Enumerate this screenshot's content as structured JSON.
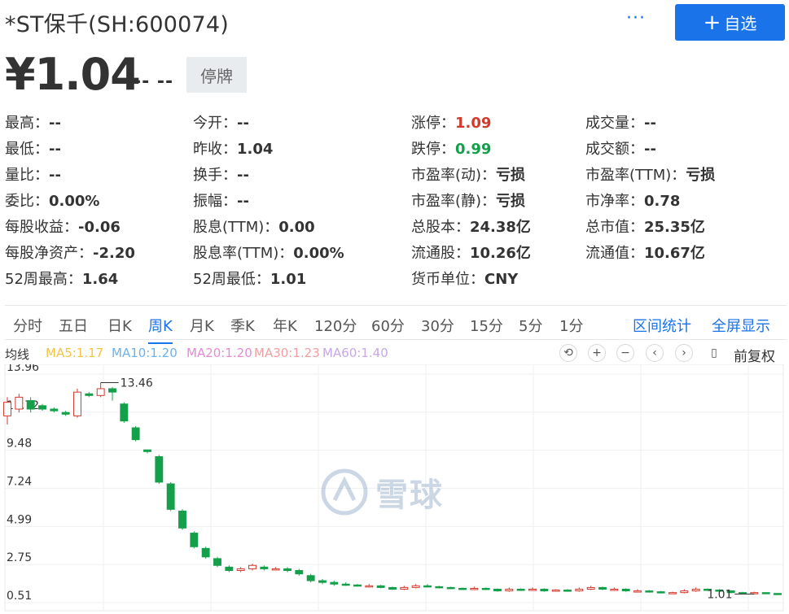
{
  "header": {
    "title": "*ST保千(SH:600074)",
    "more_label": "···",
    "add_label": "自选",
    "add_icon": "plus-icon"
  },
  "price": {
    "current": "¥1.04",
    "change": "-- --",
    "status": "停牌"
  },
  "quotes": [
    {
      "label": "最高：",
      "value": "--",
      "tone": ""
    },
    {
      "label": "今开：",
      "value": "--",
      "tone": ""
    },
    {
      "label": "涨停：",
      "value": "1.09",
      "tone": "up"
    },
    {
      "label": "成交量：",
      "value": "--",
      "tone": ""
    },
    {
      "label": "最低：",
      "value": "--",
      "tone": ""
    },
    {
      "label": "昨收：",
      "value": "1.04",
      "tone": ""
    },
    {
      "label": "跌停：",
      "value": "0.99",
      "tone": "down"
    },
    {
      "label": "成交额：",
      "value": "--",
      "tone": ""
    },
    {
      "label": "量比：",
      "value": "--",
      "tone": ""
    },
    {
      "label": "换手：",
      "value": "--",
      "tone": ""
    },
    {
      "label": "市盈率(动)：",
      "value": "亏损",
      "tone": ""
    },
    {
      "label": "市盈率(TTM)：",
      "value": "亏损",
      "tone": ""
    },
    {
      "label": "委比：",
      "value": "0.00%",
      "tone": ""
    },
    {
      "label": "振幅：",
      "value": "--",
      "tone": ""
    },
    {
      "label": "市盈率(静)：",
      "value": "亏损",
      "tone": ""
    },
    {
      "label": "市净率：",
      "value": "0.78",
      "tone": ""
    },
    {
      "label": "每股收益：",
      "value": "-0.06",
      "tone": ""
    },
    {
      "label": "股息(TTM)：",
      "value": "0.00",
      "tone": ""
    },
    {
      "label": "总股本：",
      "value": "24.38亿",
      "tone": ""
    },
    {
      "label": "总市值：",
      "value": "25.35亿",
      "tone": ""
    },
    {
      "label": "每股净资产：",
      "value": "-2.20",
      "tone": ""
    },
    {
      "label": "股息率(TTM)：",
      "value": "0.00%",
      "tone": ""
    },
    {
      "label": "流通股：",
      "value": "10.26亿",
      "tone": ""
    },
    {
      "label": "流通值：",
      "value": "10.67亿",
      "tone": ""
    },
    {
      "label": "52周最高：",
      "value": "1.64",
      "tone": ""
    },
    {
      "label": "52周最低：",
      "value": "1.01",
      "tone": ""
    },
    {
      "label": "货币单位：",
      "value": "CNY",
      "tone": ""
    }
  ],
  "periods": {
    "tabs": [
      "分时",
      "五日",
      "日K",
      "周K",
      "月K",
      "季K",
      "年K",
      "120分",
      "60分",
      "30分",
      "15分",
      "5分",
      "1分"
    ],
    "active": "周K",
    "links": [
      "区间统计",
      "全屏显示"
    ]
  },
  "ma": {
    "title": "均线",
    "items": [
      {
        "label": "MA5:1.17",
        "color": "#f5c542"
      },
      {
        "label": "MA10:1.20",
        "color": "#6cb2e8"
      },
      {
        "label": "MA20:1.20",
        "color": "#e58ad6"
      },
      {
        "label": "MA30:1.23",
        "color": "#f0a0a0"
      },
      {
        "label": "MA60:1.40",
        "color": "#c9a6e6"
      }
    ],
    "controls": [
      "undo-icon",
      "zoom-in-icon",
      "zoom-out-icon",
      "scroll-left-icon",
      "scroll-right-icon",
      "candle-type-icon"
    ],
    "adjust": "前复权"
  },
  "chart_data": {
    "type": "candlestick",
    "y_ticks": [
      "13.96",
      "11.72",
      "9.48",
      "7.24",
      "4.99",
      "2.75",
      "0.51"
    ],
    "ylim": [
      0.51,
      13.96
    ],
    "max_label": "13.46",
    "min_label": "1.01",
    "candles": [
      {
        "o": 11.5,
        "c": 12.3,
        "h": 12.6,
        "l": 11.0
      },
      {
        "o": 11.9,
        "c": 12.6,
        "h": 12.8,
        "l": 11.7
      },
      {
        "o": 12.4,
        "c": 11.9,
        "h": 12.6,
        "l": 11.7
      },
      {
        "o": 12.1,
        "c": 11.9,
        "h": 12.2,
        "l": 11.8
      },
      {
        "o": 11.9,
        "c": 11.8,
        "h": 12.0,
        "l": 11.7
      },
      {
        "o": 11.7,
        "c": 11.6,
        "h": 11.8,
        "l": 11.5
      },
      {
        "o": 11.5,
        "c": 12.9,
        "h": 13.1,
        "l": 11.4
      },
      {
        "o": 12.8,
        "c": 12.7,
        "h": 12.9,
        "l": 12.6
      },
      {
        "o": 12.7,
        "c": 13.1,
        "h": 13.46,
        "l": 12.6
      },
      {
        "o": 13.1,
        "c": 12.9,
        "h": 13.2,
        "l": 12.4
      },
      {
        "o": 12.2,
        "c": 11.2,
        "h": 12.3,
        "l": 11.1
      },
      {
        "o": 10.8,
        "c": 10.1,
        "h": 10.9,
        "l": 10.0
      },
      {
        "o": 9.5,
        "c": 9.4,
        "h": 9.5,
        "l": 9.3
      },
      {
        "o": 9.1,
        "c": 7.6,
        "h": 9.2,
        "l": 7.5
      },
      {
        "o": 7.5,
        "c": 6.0,
        "h": 7.6,
        "l": 5.9
      },
      {
        "o": 5.9,
        "c": 4.9,
        "h": 6.0,
        "l": 4.8
      },
      {
        "o": 4.6,
        "c": 3.8,
        "h": 4.7,
        "l": 3.7
      },
      {
        "o": 3.7,
        "c": 3.2,
        "h": 3.8,
        "l": 3.1
      },
      {
        "o": 3.1,
        "c": 2.7,
        "h": 3.2,
        "l": 2.6
      },
      {
        "o": 2.6,
        "c": 2.4,
        "h": 2.7,
        "l": 2.3
      },
      {
        "o": 2.4,
        "c": 2.5,
        "h": 2.6,
        "l": 2.3
      },
      {
        "o": 2.5,
        "c": 2.7,
        "h": 2.8,
        "l": 2.4
      },
      {
        "o": 2.6,
        "c": 2.5,
        "h": 2.7,
        "l": 2.4
      },
      {
        "o": 2.5,
        "c": 2.5,
        "h": 2.6,
        "l": 2.4
      },
      {
        "o": 2.5,
        "c": 2.4,
        "h": 2.6,
        "l": 2.3
      },
      {
        "o": 2.4,
        "c": 2.2,
        "h": 2.5,
        "l": 2.1
      },
      {
        "o": 2.1,
        "c": 1.8,
        "h": 2.2,
        "l": 1.7
      },
      {
        "o": 1.8,
        "c": 1.7,
        "h": 1.9,
        "l": 1.6
      },
      {
        "o": 1.7,
        "c": 1.6,
        "h": 1.8,
        "l": 1.5
      },
      {
        "o": 1.6,
        "c": 1.55,
        "h": 1.7,
        "l": 1.5
      },
      {
        "o": 1.55,
        "c": 1.5,
        "h": 1.6,
        "l": 1.45
      },
      {
        "o": 1.5,
        "c": 1.5,
        "h": 1.6,
        "l": 1.4
      },
      {
        "o": 1.5,
        "c": 1.4,
        "h": 1.55,
        "l": 1.35
      },
      {
        "o": 1.4,
        "c": 1.3,
        "h": 1.45,
        "l": 1.25
      },
      {
        "o": 1.3,
        "c": 1.4,
        "h": 1.5,
        "l": 1.25
      },
      {
        "o": 1.4,
        "c": 1.5,
        "h": 1.6,
        "l": 1.35
      },
      {
        "o": 1.5,
        "c": 1.45,
        "h": 1.6,
        "l": 1.4
      },
      {
        "o": 1.45,
        "c": 1.4,
        "h": 1.5,
        "l": 1.35
      },
      {
        "o": 1.4,
        "c": 1.35,
        "h": 1.45,
        "l": 1.3
      },
      {
        "o": 1.35,
        "c": 1.3,
        "h": 1.4,
        "l": 1.25
      },
      {
        "o": 1.3,
        "c": 1.35,
        "h": 1.45,
        "l": 1.25
      },
      {
        "o": 1.35,
        "c": 1.3,
        "h": 1.4,
        "l": 1.25
      },
      {
        "o": 1.3,
        "c": 1.2,
        "h": 1.35,
        "l": 1.15
      },
      {
        "o": 1.2,
        "c": 1.3,
        "h": 1.4,
        "l": 1.15
      },
      {
        "o": 1.3,
        "c": 1.25,
        "h": 1.35,
        "l": 1.2
      },
      {
        "o": 1.25,
        "c": 1.3,
        "h": 1.4,
        "l": 1.2
      },
      {
        "o": 1.3,
        "c": 1.2,
        "h": 1.35,
        "l": 1.15
      },
      {
        "o": 1.2,
        "c": 1.25,
        "h": 1.3,
        "l": 1.15
      },
      {
        "o": 1.25,
        "c": 1.2,
        "h": 1.3,
        "l": 1.15
      },
      {
        "o": 1.2,
        "c": 1.3,
        "h": 1.4,
        "l": 1.15
      },
      {
        "o": 1.3,
        "c": 1.4,
        "h": 1.5,
        "l": 1.25
      },
      {
        "o": 1.4,
        "c": 1.3,
        "h": 1.45,
        "l": 1.25
      },
      {
        "o": 1.3,
        "c": 1.3,
        "h": 1.4,
        "l": 1.2
      },
      {
        "o": 1.3,
        "c": 1.2,
        "h": 1.35,
        "l": 1.15
      },
      {
        "o": 1.2,
        "c": 1.2,
        "h": 1.3,
        "l": 1.15
      },
      {
        "o": 1.2,
        "c": 1.15,
        "h": 1.25,
        "l": 1.1
      },
      {
        "o": 1.15,
        "c": 1.1,
        "h": 1.2,
        "l": 1.05
      },
      {
        "o": 1.1,
        "c": 1.1,
        "h": 1.15,
        "l": 1.05
      },
      {
        "o": 1.1,
        "c": 1.2,
        "h": 1.3,
        "l": 1.05
      },
      {
        "o": 1.2,
        "c": 1.3,
        "h": 1.4,
        "l": 1.15
      },
      {
        "o": 1.3,
        "c": 1.25,
        "h": 1.35,
        "l": 1.2
      },
      {
        "o": 1.25,
        "c": 1.2,
        "h": 1.3,
        "l": 1.15
      },
      {
        "o": 1.2,
        "c": 1.1,
        "h": 1.25,
        "l": 1.05
      },
      {
        "o": 1.1,
        "c": 1.05,
        "h": 1.15,
        "l": 1.01
      },
      {
        "o": 1.05,
        "c": 1.1,
        "h": 1.15,
        "l": 1.01
      },
      {
        "o": 1.1,
        "c": 1.05,
        "h": 1.12,
        "l": 1.02
      },
      {
        "o": 1.05,
        "c": 1.04,
        "h": 1.08,
        "l": 1.02
      }
    ]
  },
  "watermark": {
    "text": "雪球",
    "icon": "snowball-logo-icon"
  }
}
